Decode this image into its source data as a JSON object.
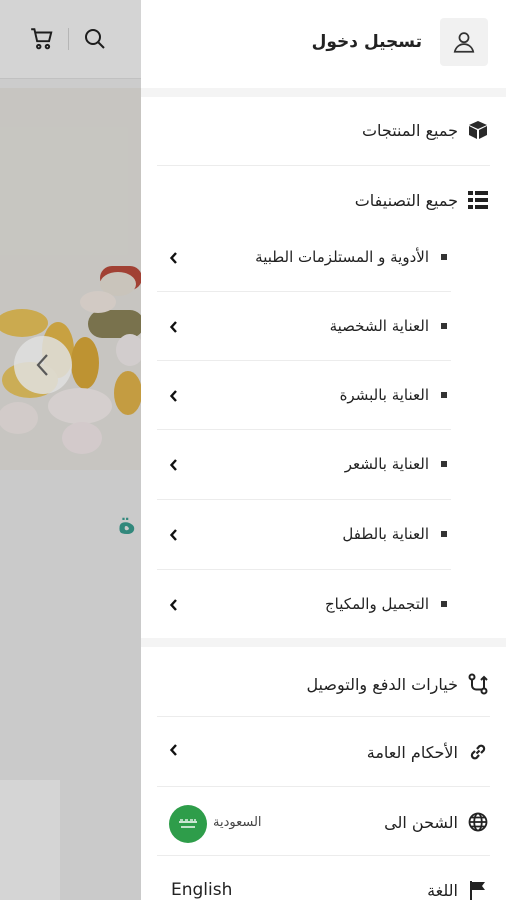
{
  "drawer": {
    "login_label": "تسجيل دخول",
    "all_products": "جميع المنتجات",
    "all_categories": "جميع التصنيفات",
    "categories": [
      {
        "label": "الأدوية و المستلزمات الطبية"
      },
      {
        "label": "العناية الشخصية"
      },
      {
        "label": "العناية بالبشرة"
      },
      {
        "label": "العناية بالشعر"
      },
      {
        "label": "العناية بالطفل"
      },
      {
        "label": "التجميل والمكياج"
      }
    ],
    "payment_delivery": "خيارات الدفع والتوصيل",
    "terms": "الأحكام العامة",
    "shipping_to": "الشحن الى",
    "shipping_country": "السعودية",
    "language_label": "اللغة",
    "language_value": "English"
  },
  "background": {
    "teal_text_fragment": "ة",
    "accent_teal": "#3a9b8e"
  },
  "icons": [
    "cart-icon",
    "search-icon",
    "user-icon",
    "box-icon",
    "list-icon",
    "chevron-left-icon",
    "route-icon",
    "link-icon",
    "globe-icon",
    "flag-icon",
    "saudi-flag-icon"
  ]
}
